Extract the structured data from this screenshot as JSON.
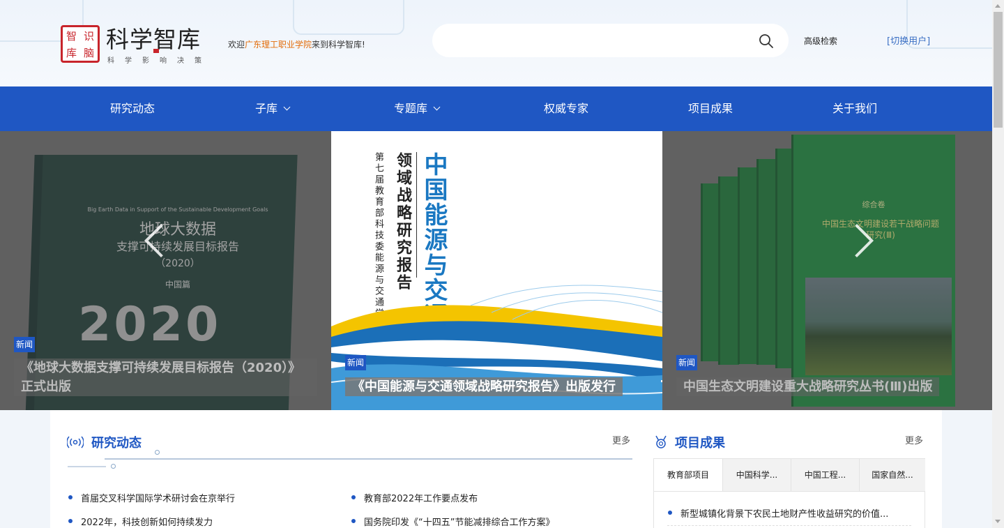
{
  "header": {
    "logo_seal_chars": [
      "智",
      "识",
      "库",
      "脑"
    ],
    "logo_title": "科学智库",
    "logo_subtitle": "科学影响决策",
    "welcome_prefix": "欢迎",
    "welcome_school": "广东理工职业学院",
    "welcome_suffix": "来到科学智库!",
    "search_placeholder": "",
    "search_icon": "search-icon",
    "advanced_search": "高级检索",
    "switch_user": "[切换用户]"
  },
  "nav": {
    "items": [
      {
        "label": "研究动态",
        "dropdown": false
      },
      {
        "label": "子库",
        "dropdown": true
      },
      {
        "label": "专题库",
        "dropdown": true
      },
      {
        "label": "权威专家",
        "dropdown": false
      },
      {
        "label": "项目成果",
        "dropdown": false
      },
      {
        "label": "关于我们",
        "dropdown": false
      }
    ]
  },
  "carousel": {
    "slides": [
      {
        "tag": "新闻",
        "caption_line1": "《地球大数据支撑可持续发展目标报告（2020）》",
        "caption_line2": "正式出版",
        "cover_text_en": "Big Earth Data in Support of the Sustainable Development Goals",
        "cover_title": "地球大数据",
        "cover_subtitle": "支撑可持续发展目标报告",
        "cover_year": "（2020）",
        "cover_edition": "中国篇",
        "cover_big_year": "2020"
      },
      {
        "tag": "新闻",
        "caption": "《中国能源与交通领域战略研究报告》出版发行",
        "cover_title": "中国能源与交通",
        "cover_subtitle": "领域战略研究报告",
        "cover_small": "第七届教育部科技委能源与交通学部"
      },
      {
        "tag": "新闻",
        "caption": "中国生态文明建设重大战略研究丛书(Ⅲ)出版",
        "cover_volume": "综合卷",
        "cover_title": "中国生态文明建设若干战略问题研究(Ⅲ)"
      }
    ],
    "prev_icon": "chevron-left-icon",
    "next_icon": "chevron-right-icon"
  },
  "research": {
    "title": "研究动态",
    "more": "更多",
    "icon": "broadcast-icon",
    "items": [
      "首届交叉科学国际学术研讨会在京举行",
      "教育部2022年工作要点发布",
      "2022年，科技创新如何持续发力",
      "国务院印发《“十四五”节能减排综合工作方案》"
    ]
  },
  "projects": {
    "title": "项目成果",
    "more": "更多",
    "icon": "medal-icon",
    "tabs": [
      "教育部项目",
      "中国科学...",
      "中国工程...",
      "国家自然..."
    ],
    "active_tab": 0,
    "items": [
      "新型城镇化背景下农民土地财产性收益研究的价值..."
    ]
  },
  "colors": {
    "nav_blue": "#1f57c3",
    "school_orange": "#e36c09",
    "seal_red": "#c8242b"
  }
}
